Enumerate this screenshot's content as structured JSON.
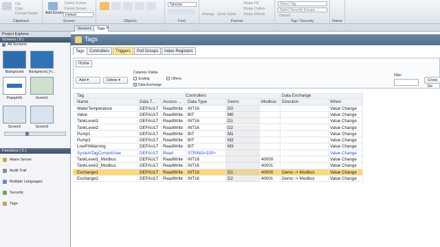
{
  "ribbon": {
    "clipboard": {
      "label": "Clipboard",
      "items": [
        "Cut",
        "Copy",
        "Format Painter"
      ]
    },
    "screen": {
      "label": "Screen",
      "add_label": "Add Screen",
      "items": [
        "Delete Screen",
        "Parent Screen"
      ],
      "combo": "Default"
    },
    "objects": {
      "label": "Objects"
    },
    "font": {
      "label": "Font",
      "combo": "Tahoma"
    },
    "format": {
      "label": "Format",
      "items": [
        "Arrange",
        "Quick Styles",
        "Shape Fill",
        "Shape Outline",
        "Shape Effects"
      ]
    },
    "tag_security": {
      "label": "Tag / Security",
      "combos": [
        "Select Tag...",
        "Select Security Groups..."
      ],
      "default_label": "Default"
    },
    "name": {
      "label": "Name"
    }
  },
  "doc_tabs": [
    "Screen1",
    "Tags"
  ],
  "project_explorer": {
    "title": "Project Explorer",
    "screens_header": "Screens ( 8 )",
    "all_screens": "All Screens",
    "screens": [
      "Background",
      "Background_Fr...",
      "PopupInfo",
      "Screen1",
      "Screen2",
      "Screen3"
    ],
    "functions_header": "Functions ( 5 )",
    "functions": [
      "Alarm Server",
      "Audit Trail",
      "Multiple Languages",
      "Security",
      "Tags"
    ]
  },
  "main": {
    "title": "Tags",
    "tabs": [
      "Tags",
      "Controllers",
      "Triggers",
      "Poll Groups",
      "Index Registers"
    ],
    "home_tab": "Home",
    "buttons": {
      "add": "Add",
      "delete": "Delete"
    },
    "columns_visible": "Columns Visible",
    "checkboxes": [
      {
        "label": "Scaling",
        "checked": false
      },
      {
        "label": "Others",
        "checked": false
      },
      {
        "label": "Data Exchange",
        "checked": true
      }
    ],
    "filter_label": "Filter",
    "cross_ref": "Cross Re"
  },
  "grid": {
    "group_headers": [
      "Tag",
      "Controllers",
      "Data Exchange"
    ],
    "columns": [
      "Name",
      "Data T...",
      "Access ...",
      "Data Type",
      "Demo",
      "Modbus",
      "Direction",
      "When"
    ],
    "rows": [
      [
        "WaterTemperature",
        "DEFAULT",
        "ReadWrite",
        "INT16",
        "D0",
        "",
        "",
        "Value Change"
      ],
      [
        "Valve",
        "DEFAULT",
        "ReadWrite",
        "BIT",
        "M0",
        "",
        "",
        "Value Change"
      ],
      [
        "TankLevel1",
        "DEFAULT",
        "ReadWrite",
        "INT16",
        "D1",
        "",
        "",
        "Value Change"
      ],
      [
        "TankLevel2",
        "DEFAULT",
        "ReadWrite",
        "INT16",
        "D2",
        "",
        "",
        "Value Change"
      ],
      [
        "Pump1",
        "DEFAULT",
        "ReadWrite",
        "BIT",
        "M1",
        "",
        "",
        "Value Change"
      ],
      [
        "Pump2",
        "DEFAULT",
        "ReadWrite",
        "BIT",
        "M2",
        "",
        "",
        "Value Change"
      ],
      [
        "LowPhWarning",
        "DEFAULT",
        "ReadWrite",
        "BIT",
        "M3",
        "",
        "",
        "Value Change"
      ],
      [
        "SystemTagCurrentUser",
        "DEFAULT",
        "Read",
        "STRING<100>",
        "",
        "",
        "",
        "Value Change"
      ],
      [
        "TankLevel1_Modbus",
        "DEFAULT",
        "ReadWrite",
        "INT16",
        "",
        "40000",
        "",
        "Value Change"
      ],
      [
        "TankLevel2_Modbus",
        "DEFAULT",
        "ReadWrite",
        "INT16",
        "",
        "40001",
        "",
        "Value Change"
      ],
      [
        "Exchange1",
        "DEFAULT",
        "ReadWrite",
        "INT16",
        "D1",
        "40000",
        "Demo -> Modbus",
        "Value Change"
      ],
      [
        "Exchange2",
        "DEFAULT",
        "ReadWrite",
        "INT16",
        "D2",
        "40001",
        "Demo -> Modbus",
        "Value Change"
      ]
    ]
  }
}
